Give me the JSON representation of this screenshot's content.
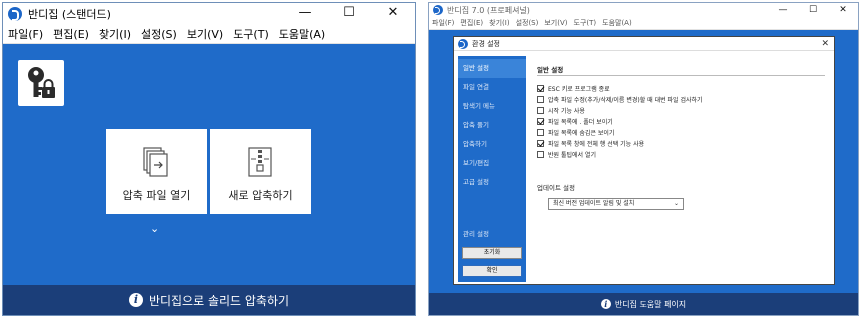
{
  "left_window": {
    "title": "반디집 (스탠더드)",
    "window_buttons": [
      "—",
      "☐",
      "✕"
    ],
    "menu": [
      "파일(F)",
      "편집(E)",
      "찾기(I)",
      "설정(S)",
      "보기(V)",
      "도구(T)",
      "도움말(A)"
    ],
    "tiles": {
      "open_archive": "압축 파일 열기",
      "new_archive": "새로 압축하기"
    },
    "expand_chevron": "⌄",
    "footer_text": "반디집으로 솔리드 압축하기",
    "footer_icon": "i"
  },
  "right_window": {
    "title": "반디집 7.0 (프로페셔널)",
    "window_buttons": [
      "—",
      "☐",
      "✕"
    ],
    "menu": [
      "파일(F)",
      "편집(E)",
      "찾기(I)",
      "설정(S)",
      "보기(V)",
      "도구(T)",
      "도움말(A)"
    ],
    "footer_text": "반디집 도움말 페이지",
    "footer_icon": "i",
    "dialog": {
      "title": "환경 설정",
      "close": "✕",
      "sidebar": [
        "일반 설정",
        "파일 연결",
        "탐색기 메뉴",
        "압축 풀기",
        "압축하기",
        "보기/편집",
        "고급 설정",
        "관리 설정"
      ],
      "active_index": 0,
      "reset_button": "초기화",
      "ok_button": "확인",
      "section_general": "일반 설정",
      "options": [
        {
          "label": "ESC 키로 프로그램 종료",
          "checked": true
        },
        {
          "label": "압축 파일 수정(추가/삭제/이름 변경)할 때 대번 파일 검사하기",
          "checked": false
        },
        {
          "label": "시작 기능 사용",
          "checked": false
        },
        {
          "label": "파일 목록에 . 폴더 보이기",
          "checked": true
        },
        {
          "label": "파일 목록에 숨김은 보이기",
          "checked": false
        },
        {
          "label": "파일 목록 창에 전체 행 선택 기능 사용",
          "checked": true
        },
        {
          "label": "반원 툴팁에서 열기",
          "checked": false
        }
      ],
      "section_update": "업데이트 설정",
      "update_select": "최신 버전 업데이트 알림 및 설치",
      "select_arrow": "⌄"
    }
  },
  "colors": {
    "app_blue": "#1f6bc9",
    "footer_navy": "#1b3e79"
  }
}
